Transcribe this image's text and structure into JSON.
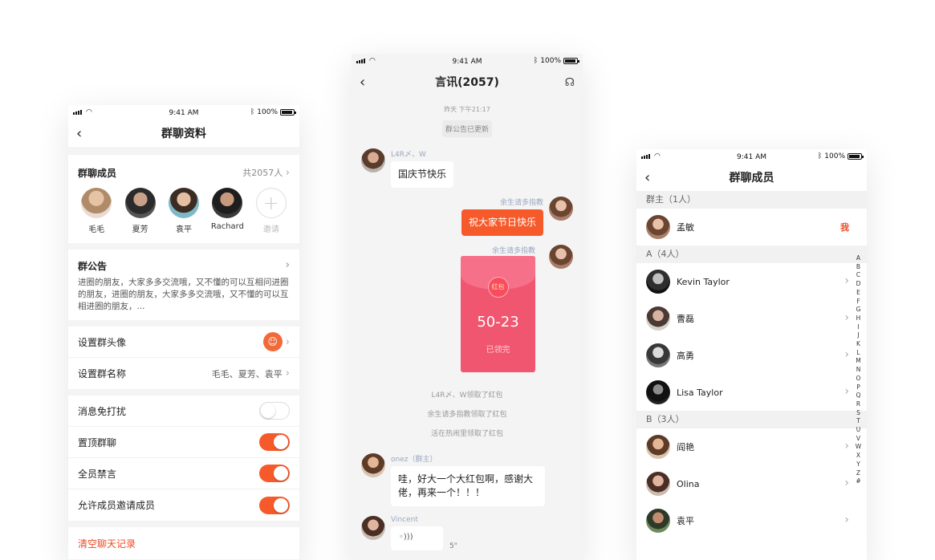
{
  "status": {
    "time": "9:41 AM",
    "battery": "100%"
  },
  "phone1": {
    "title": "群聊资料",
    "members_label": "群聊成员",
    "members_count": "共2057人",
    "members": [
      {
        "name": "毛毛"
      },
      {
        "name": "夏芳"
      },
      {
        "name": "袁平"
      },
      {
        "name": "Rachard"
      }
    ],
    "invite_label": "邀请",
    "notice_title": "群公告",
    "notice_text": "进圈的朋友，大家多多交流哦，又不懂的可以互相问进圈的朋友，进圈的朋友，大家多多交流哦，又不懂的可以互相进圈的朋友，...",
    "set_avatar": "设置群头像",
    "set_name": "设置群名称",
    "group_name_value": "毛毛、夏芳、袁平",
    "toggles": [
      {
        "label": "消息免打扰",
        "on": false
      },
      {
        "label": "置顶群聊",
        "on": true
      },
      {
        "label": "全员禁言",
        "on": true
      },
      {
        "label": "允许成员邀请成员",
        "on": true
      }
    ],
    "clear_history": "清空聊天记录"
  },
  "phone2": {
    "title": "言讯(2057)",
    "date": "昨天 下午21:17",
    "notice_updated": "群公告已更新",
    "msg1_nick": "L4R〆、W",
    "msg1_text": "国庆节快乐",
    "msg2_nick": "余生请多指教",
    "msg2_text": "祝大家节日快乐",
    "msg3_nick": "余生请多指教",
    "redpack_tag": "红包",
    "redpack_amount": "50-23",
    "redpack_status": "已领完",
    "sys1": "L4R〆、W领取了红包",
    "sys2": "余生请多指教领取了红包",
    "sys3": "活在热闹里领取了红包",
    "msg4_nick": "onez（群主）",
    "msg4_text": "哇，好大一个大红包啊，感谢大佬，再来一个！！！",
    "msg5_nick": "Vincent",
    "voice_duration": "5\""
  },
  "phone3": {
    "title": "群聊成员",
    "owner_head": "群主（1人）",
    "owner_name": "孟敏",
    "me_tag": "我",
    "a_head": "A（4人）",
    "a_members": [
      "Kevin Taylor",
      "曹磊",
      "高勇",
      "Lisa Taylor"
    ],
    "b_head": "B（3人）",
    "b_members": [
      "阎艳",
      "Olina",
      "袁平"
    ],
    "alphabet": [
      "A",
      "B",
      "C",
      "D",
      "E",
      "F",
      "G",
      "H",
      "I",
      "J",
      "K",
      "L",
      "M",
      "N",
      "O",
      "P",
      "Q",
      "R",
      "S",
      "T",
      "U",
      "V",
      "W",
      "X",
      "Y",
      "Z",
      "#"
    ]
  },
  "colors": {
    "accent": "#f65a2b",
    "redpack": "#f0566f",
    "danger": "#f04a22"
  }
}
